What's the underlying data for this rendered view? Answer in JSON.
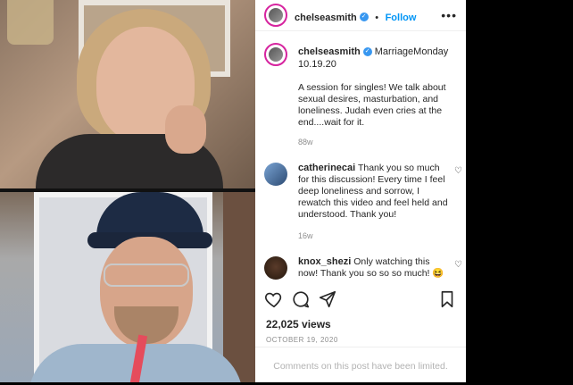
{
  "post": {
    "username": "chelseasmith",
    "follow_label": "Follow",
    "more_label": "•••"
  },
  "caption": {
    "username": "chelseasmith",
    "hashtag": "MarriageMonday",
    "date_line": "10.19.20",
    "body": "A session for singles! We talk about sexual desires, masturbation, and loneliness. Judah even cries at the end....wait for it.",
    "age": "88w"
  },
  "comments": [
    {
      "username": "catherinecai",
      "text": "Thank you so much for this discussion! Every time I feel deep loneliness and sorrow, I rewatch this video and feel held and understood. Thank you!",
      "age": "16w"
    },
    {
      "username": "knox_shezi",
      "text": "Only watching this now! Thank you so so so much! 😆"
    }
  ],
  "footer": {
    "views": "22,025 views",
    "date": "OCTOBER 19, 2020",
    "limited_notice": "Comments on this post have been limited."
  },
  "icons": {
    "heart": "heart-icon",
    "comment": "comment-icon",
    "share": "share-icon",
    "save": "bookmark-icon",
    "verified": "verified-badge-icon"
  },
  "colors": {
    "follow": "#0095f6",
    "verified": "#3897f0",
    "ring": "#d6249f",
    "muted": "#8e8e8e"
  }
}
